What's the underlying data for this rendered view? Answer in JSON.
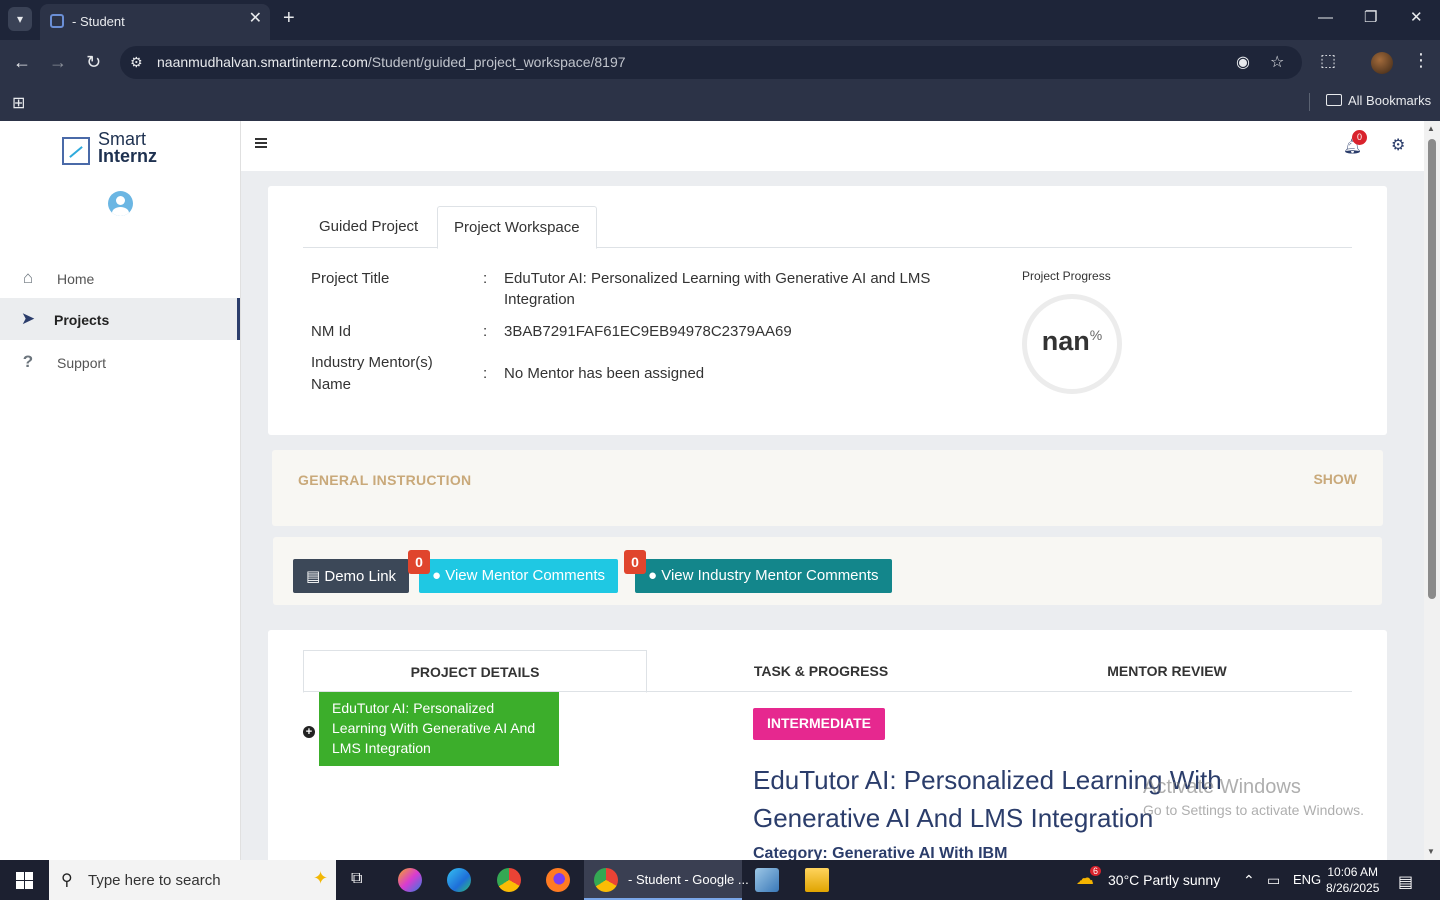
{
  "browser": {
    "tab_title": "- Student",
    "url_host": "naanmudhalvan.smartinternz.com",
    "url_path": "/Student/guided_project_workspace/8197",
    "bookmarks_label": "All Bookmarks"
  },
  "sidebar": {
    "logo_line1": "Smart",
    "logo_line2": "Internz",
    "items": [
      {
        "label": "Home",
        "icon": "home-icon"
      },
      {
        "label": "Projects",
        "icon": "paper-plane-icon"
      },
      {
        "label": "Support",
        "icon": "question-icon"
      }
    ]
  },
  "topbar": {
    "notification_count": "0"
  },
  "overview": {
    "tabs": [
      "Guided Project",
      "Project Workspace"
    ],
    "active_tab": "Project Workspace",
    "project_title_label": "Project Title",
    "project_title": "EduTutor AI: Personalized Learning with Generative AI and LMS Integration",
    "nm_id_label": "NM Id",
    "nm_id": "3BAB7291FAF61EC9EB94978C2379AA69",
    "mentor_label": "Industry Mentor(s) Name",
    "mentor_value": "No Mentor has been assigned",
    "colon": ":",
    "progress_label": "Project Progress",
    "progress_value": "nan",
    "progress_unit": "%"
  },
  "general_instruction": {
    "title": "GENERAL INSTRUCTION",
    "toggle": "SHOW"
  },
  "actions": {
    "demo_link": "Demo Link",
    "view_mentor_comments": "View Mentor Comments",
    "mentor_comments_count": "0",
    "view_industry_mentor_comments": "View Industry Mentor Comments",
    "industry_comments_count": "0"
  },
  "details": {
    "tabs": [
      "PROJECT DETAILS",
      "TASK & PROGRESS",
      "MENTOR REVIEW"
    ],
    "active_tab": "PROJECT DETAILS",
    "project_card": "EduTutor AI: Personalized Learning With Generative AI And LMS Integration",
    "level": "INTERMEDIATE",
    "title": "EduTutor AI: Personalized Learning With Generative AI And LMS Integration",
    "category": "Category: Generative AI With IBM"
  },
  "watermark": {
    "line1": "Activate Windows",
    "line2": "Go to Settings to activate Windows."
  },
  "taskbar": {
    "search_placeholder": "Type here to search",
    "active_app_label": "- Student - Google ...",
    "weather_badge": "6",
    "weather": "30°C  Partly sunny",
    "language": "ENG",
    "time": "10:06 AM",
    "date": "8/26/2025"
  }
}
